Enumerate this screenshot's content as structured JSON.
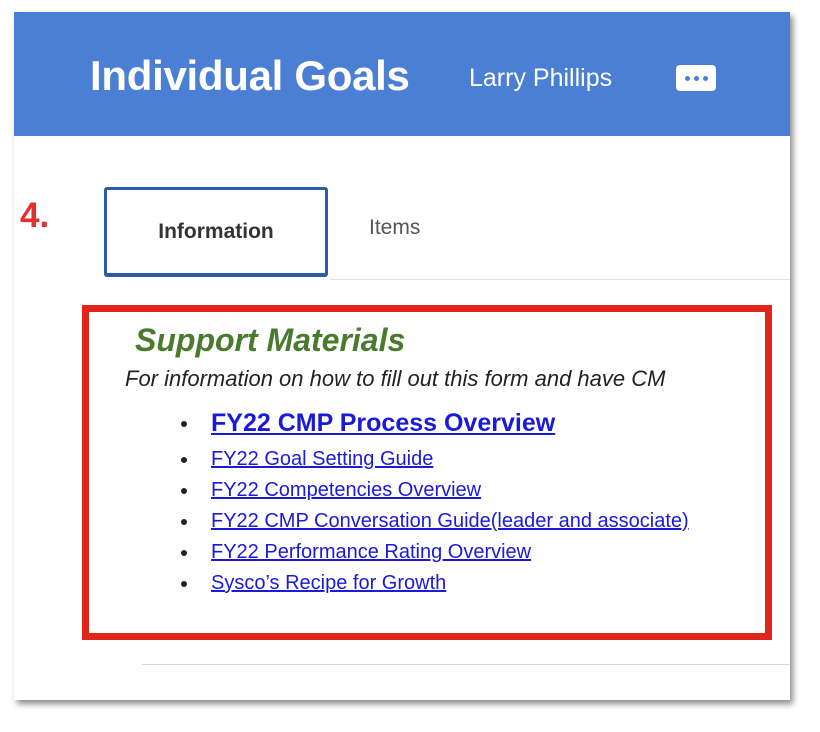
{
  "header": {
    "title": "Individual Goals",
    "worker_name": "Larry Phillips",
    "more_icon": "ellipsis-icon"
  },
  "annotation": {
    "step": "4."
  },
  "tabs": [
    {
      "label": "Information",
      "active": true
    },
    {
      "label": "Items",
      "active": false
    }
  ],
  "support": {
    "heading": "Support Materials",
    "intro": "For information on how to fill out this form and have CM",
    "links": [
      {
        "label": "FY22 CMP Process Overview "
      },
      {
        "label": "FY22 Goal Setting Guide "
      },
      {
        "label": "FY22 Competencies Overview "
      },
      {
        "label": "FY22 CMP Conversation Guide(leader and associate) "
      },
      {
        "label": "FY22 Performance Rating Overview "
      },
      {
        "label": "Sysco’s Recipe for Growth "
      }
    ]
  },
  "colors": {
    "header_bg": "#4a7fd4",
    "highlight_border": "#e1251b",
    "heading_green": "#4a7a2e",
    "link_blue": "#1a1ad8",
    "step_red": "#e03030",
    "active_tab_border": "#2b5ba8"
  }
}
